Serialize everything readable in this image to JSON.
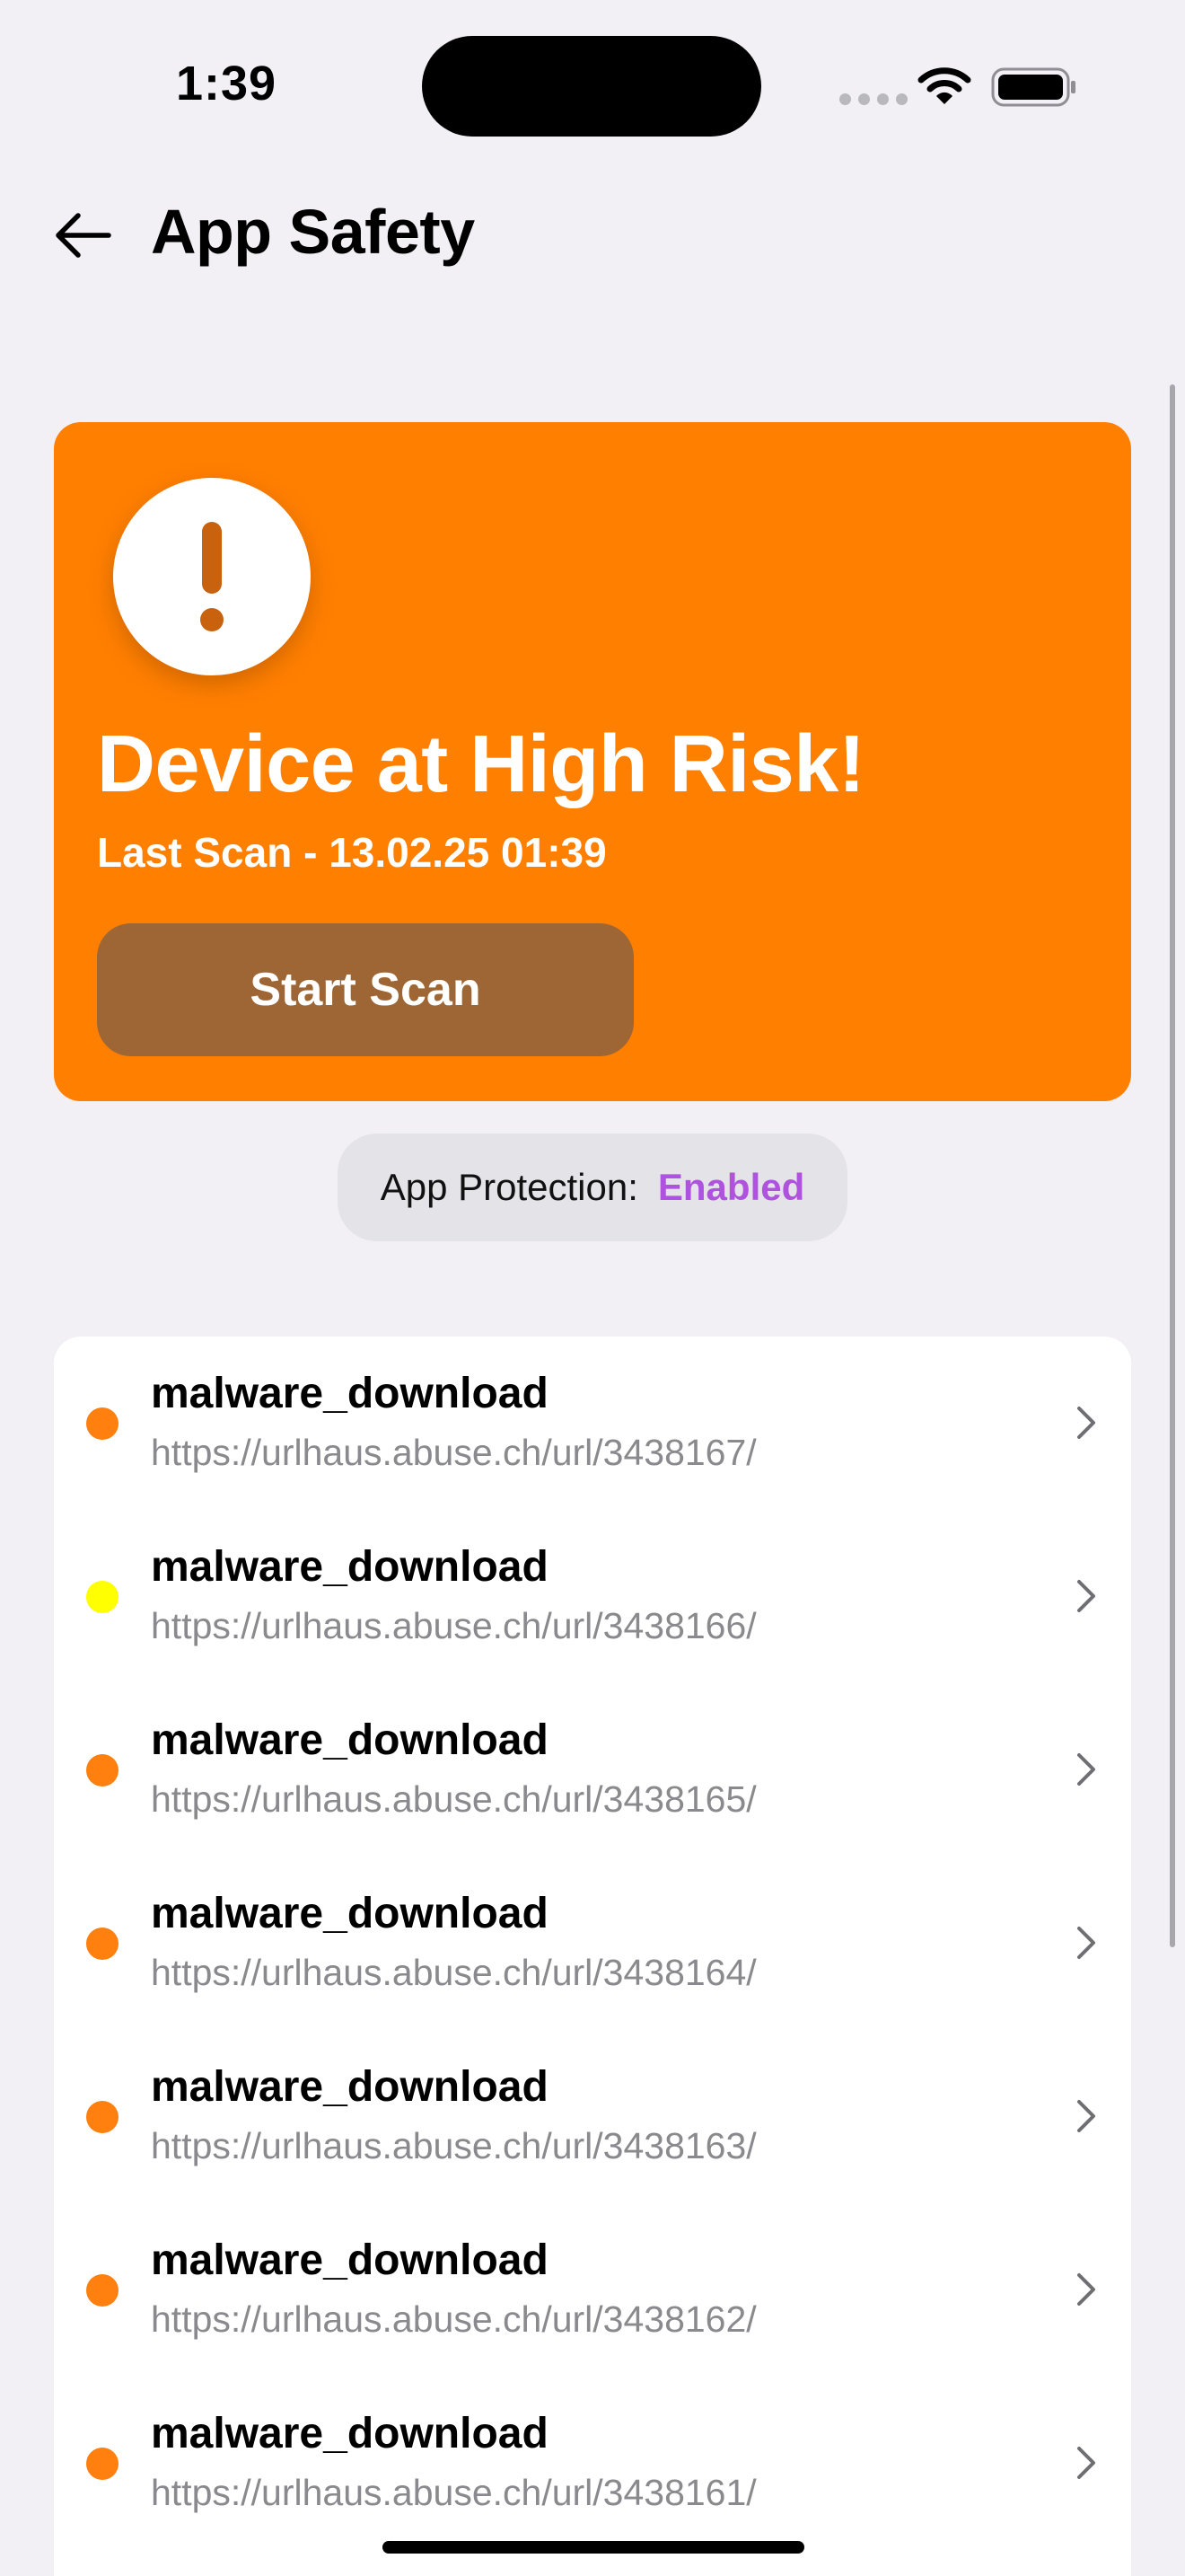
{
  "status_bar": {
    "time": "1:39"
  },
  "header": {
    "title": "App Safety"
  },
  "risk_card": {
    "title": "Device at High Risk!",
    "last_scan": "Last Scan - 13.02.25 01:39",
    "scan_button_label": "Start Scan",
    "background_color": "#ff7f00",
    "button_color": "#9e6634"
  },
  "protection": {
    "label": "App Protection:",
    "status": "Enabled",
    "status_color": "#af52de"
  },
  "threats": [
    {
      "name": "malware_download",
      "url": "https://urlhaus.abuse.ch/url/3438167/",
      "risk_color": "#ff7f0f"
    },
    {
      "name": "malware_download",
      "url": "https://urlhaus.abuse.ch/url/3438166/",
      "risk_color": "#ffff00"
    },
    {
      "name": "malware_download",
      "url": "https://urlhaus.abuse.ch/url/3438165/",
      "risk_color": "#ff7f0f"
    },
    {
      "name": "malware_download",
      "url": "https://urlhaus.abuse.ch/url/3438164/",
      "risk_color": "#ff7f0f"
    },
    {
      "name": "malware_download",
      "url": "https://urlhaus.abuse.ch/url/3438163/",
      "risk_color": "#ff7f0f"
    },
    {
      "name": "malware_download",
      "url": "https://urlhaus.abuse.ch/url/3438162/",
      "risk_color": "#ff7f0f"
    },
    {
      "name": "malware_download",
      "url": "https://urlhaus.abuse.ch/url/3438161/",
      "risk_color": "#ff7f0f"
    }
  ]
}
